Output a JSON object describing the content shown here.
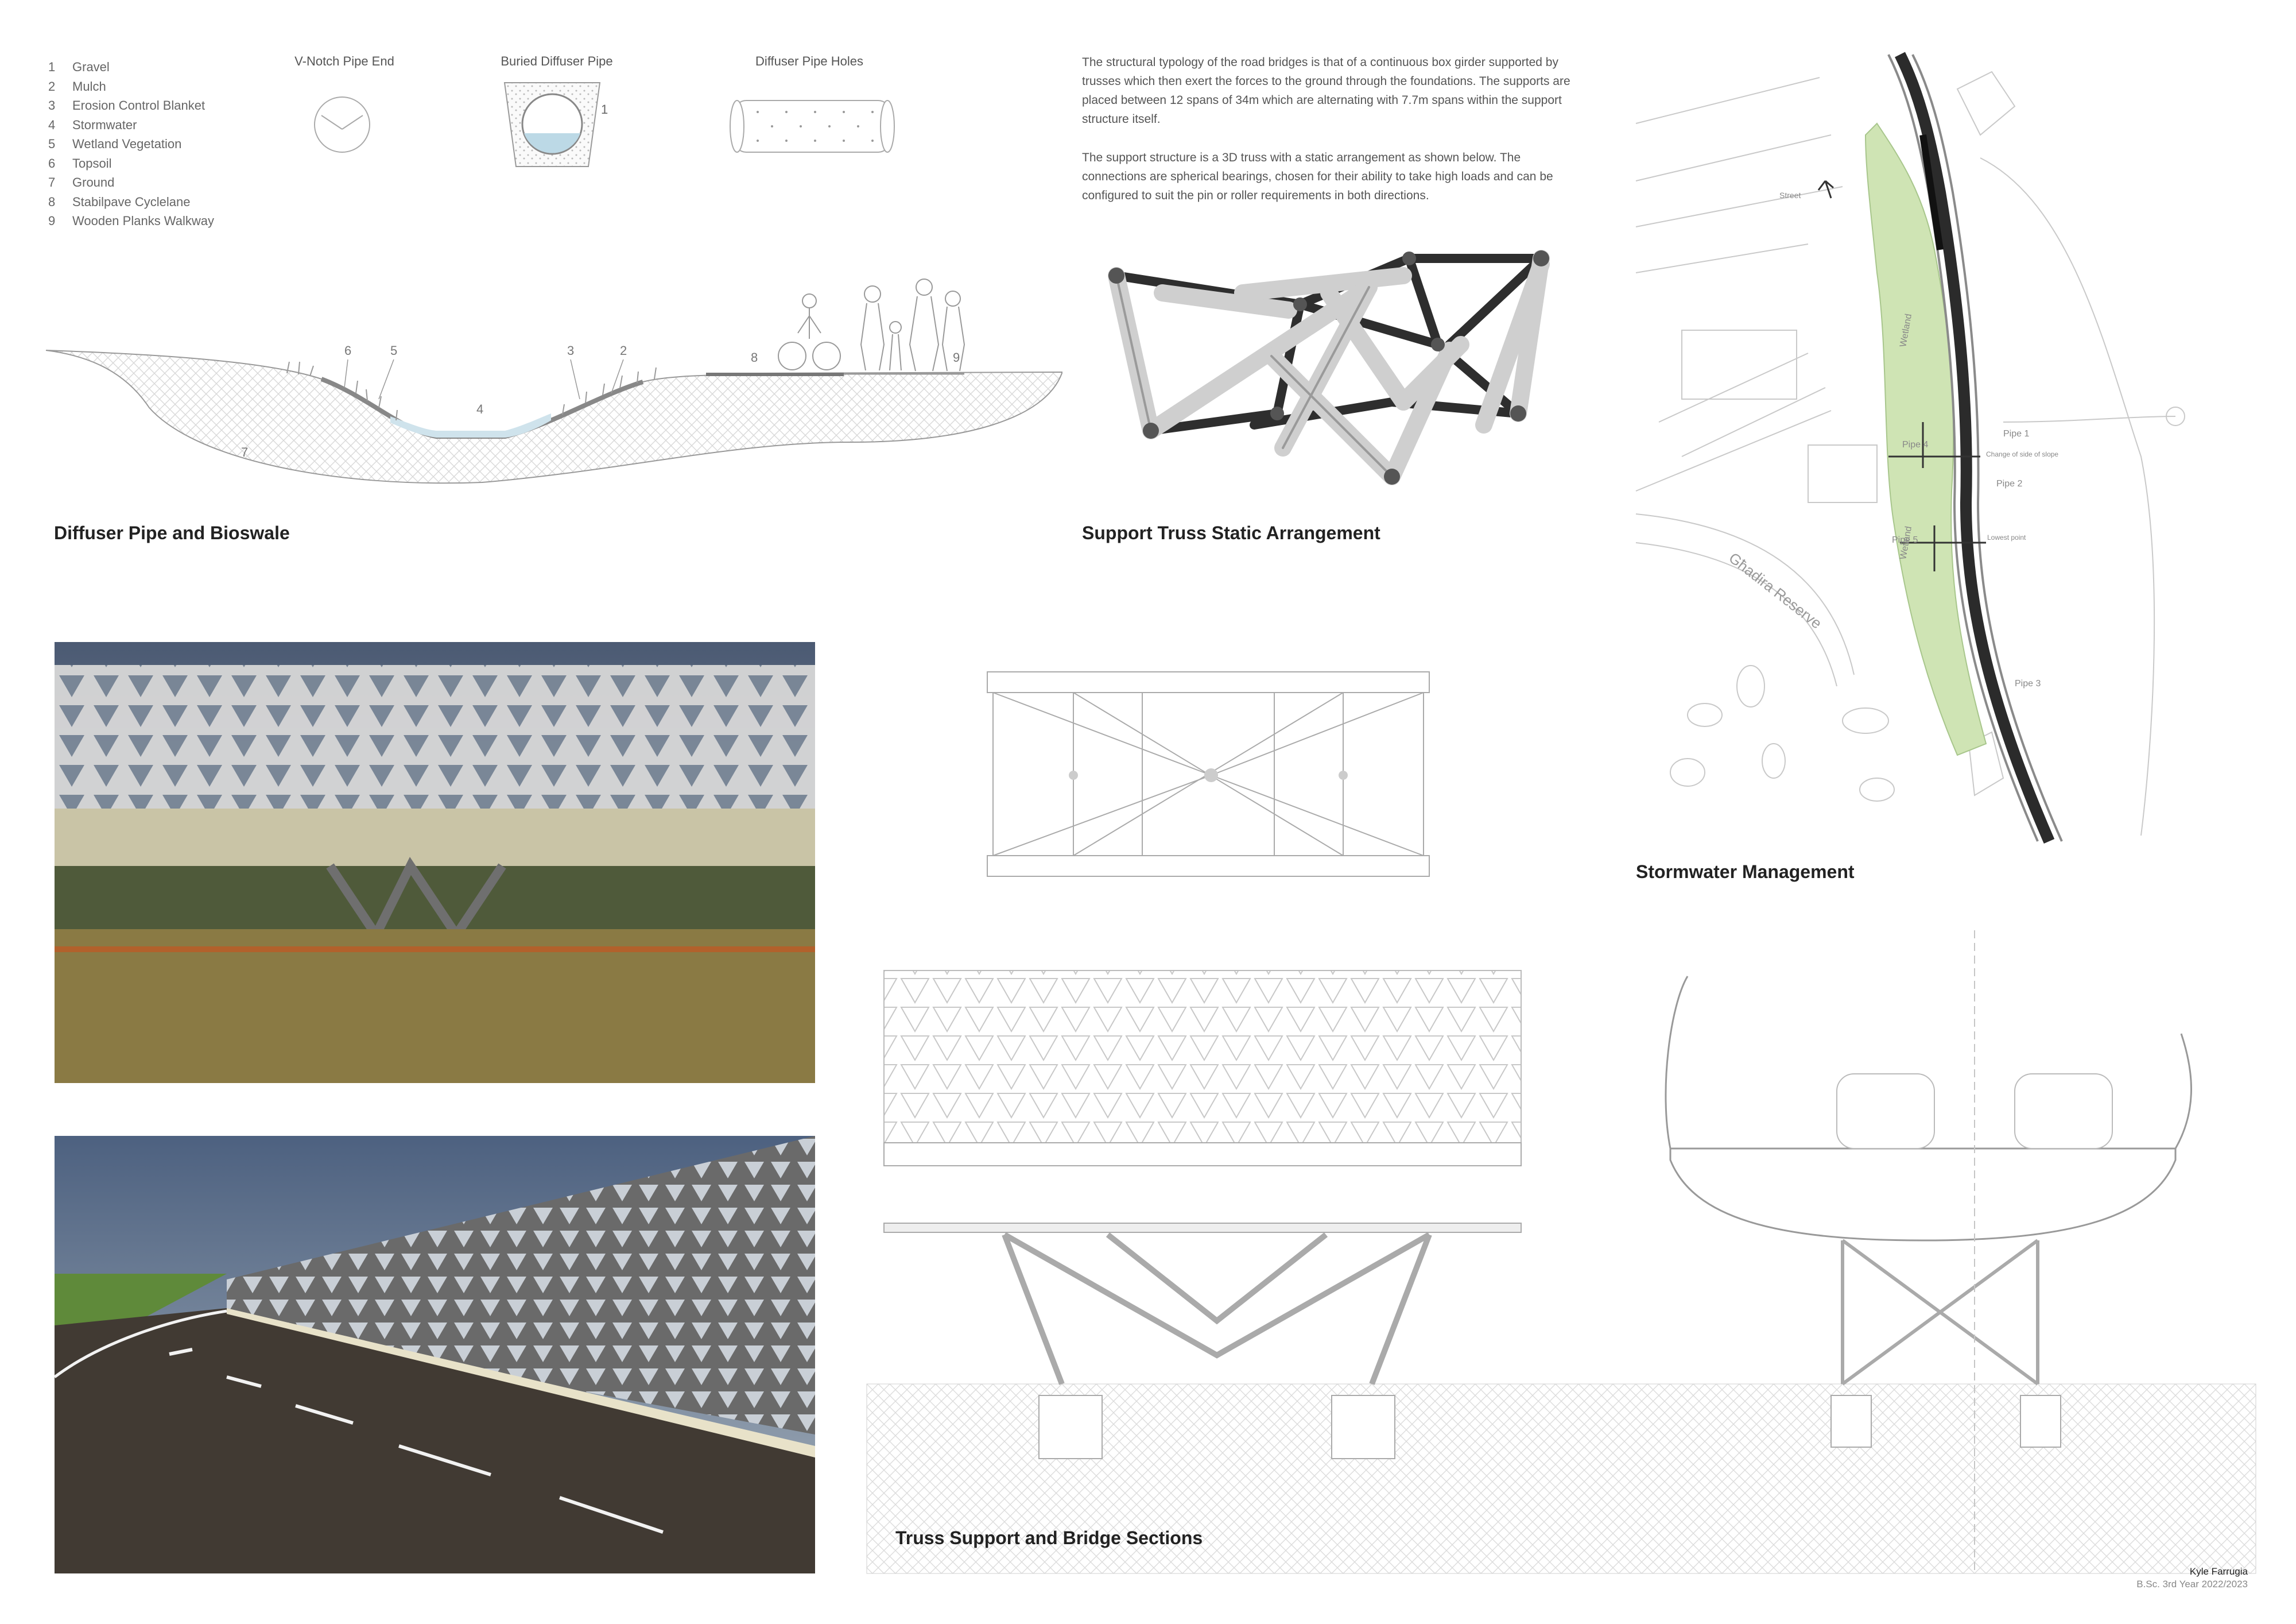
{
  "legend": [
    {
      "num": "1",
      "label": "Gravel"
    },
    {
      "num": "2",
      "label": "Mulch"
    },
    {
      "num": "3",
      "label": "Erosion Control Blanket"
    },
    {
      "num": "4",
      "label": "Stormwater"
    },
    {
      "num": "5",
      "label": "Wetland Vegetation"
    },
    {
      "num": "6",
      "label": "Topsoil"
    },
    {
      "num": "7",
      "label": "Ground"
    },
    {
      "num": "8",
      "label": "Stabilpave Cyclelane"
    },
    {
      "num": "9",
      "label": "Wooden Planks Walkway"
    }
  ],
  "details": {
    "vnotch": "V-Notch Pipe End",
    "buried": "Buried Diffuser Pipe",
    "holes": "Diffuser Pipe Holes",
    "buried_callout": "1"
  },
  "section_callouts": {
    "c6": "6",
    "c5": "5",
    "c3": "3",
    "c2": "2",
    "c4": "4",
    "c7": "7",
    "c8": "8",
    "c9": "9"
  },
  "description": {
    "p1": "The structural typology of the road bridges is that of a continuous box girder supported by trusses which then exert the forces to the ground through the foundations. The supports are placed between 12 spans of 34m which are alternating with 7.7m spans within the support structure itself.",
    "p2": "The support structure is a 3D truss with a static arrangement as shown below. The connections are spherical bearings, chosen for their ability to take high loads and can be configured to suit the pin or roller requirements in both directions."
  },
  "titles": {
    "diffuser": "Diffuser Pipe and Bioswale",
    "truss": "Support Truss Static Arrangement",
    "stormwater": "Stormwater Management",
    "sections": "Truss Support and Bridge Sections"
  },
  "map_labels": {
    "wetland_top": "Wetland",
    "wetland_bottom": "Wetland",
    "pipe1": "Pipe 1",
    "pipe2": "Pipe 2",
    "pipe3": "Pipe 3",
    "pipe4": "Pipe 4",
    "pipe5": "Pipe 5",
    "reserve": "Għadira Reserve",
    "slope_note": "Change of side of slope",
    "lowest": "Lowest point",
    "street": "Street"
  },
  "colors": {
    "wetland": "#cfe4b4",
    "road": "#2b2b2b",
    "ground_hatch": "#d6d6d6",
    "water": "#cfe3ec",
    "render_sky": "#4b5a73",
    "render_ground": "#8a7a44"
  },
  "footer": {
    "name": "Kyle Farrugia",
    "course": "B.Sc. 3rd Year 2022/2023"
  }
}
